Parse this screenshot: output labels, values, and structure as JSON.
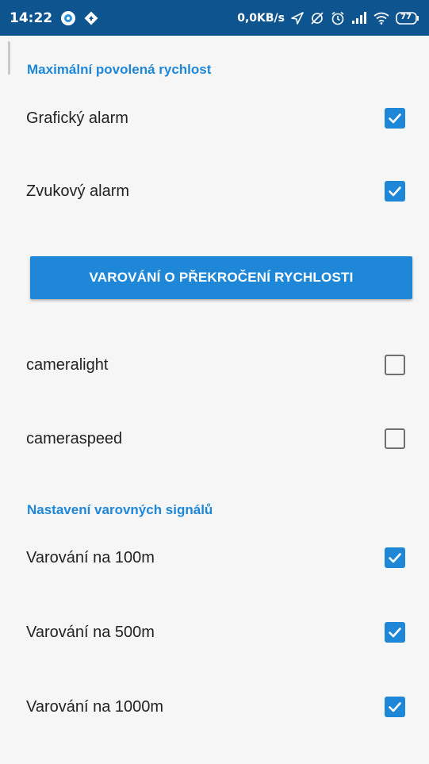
{
  "status_bar": {
    "time": "14:22",
    "network_speed": "0,0KB/s",
    "battery": "77",
    "icons": [
      "app-notification-icon",
      "navigation-icon",
      "location-arrow-icon",
      "alarm-icon",
      "signal-icon",
      "wifi-icon",
      "battery-icon"
    ]
  },
  "sections": [
    {
      "header": "Maximální povolená rychlost",
      "items": [
        {
          "label": "Grafický alarm",
          "checked": true
        },
        {
          "label": "Zvukový alarm",
          "checked": true
        }
      ]
    },
    {
      "button_label": "VAROVÁNÍ O PŘEKROČENÍ RYCHLOSTI",
      "items": [
        {
          "label": "cameralight",
          "checked": false
        },
        {
          "label": "cameraspeed",
          "checked": false
        }
      ]
    },
    {
      "header": "Nastavení varovných signálů",
      "items": [
        {
          "label": "Varování na 100m",
          "checked": true
        },
        {
          "label": "Varování na 500m",
          "checked": true
        },
        {
          "label": "Varování na 1000m",
          "checked": true
        }
      ]
    }
  ],
  "colors": {
    "status_bar": "#0e5590",
    "accent": "#1e87d8",
    "background": "#f6f6f6"
  }
}
